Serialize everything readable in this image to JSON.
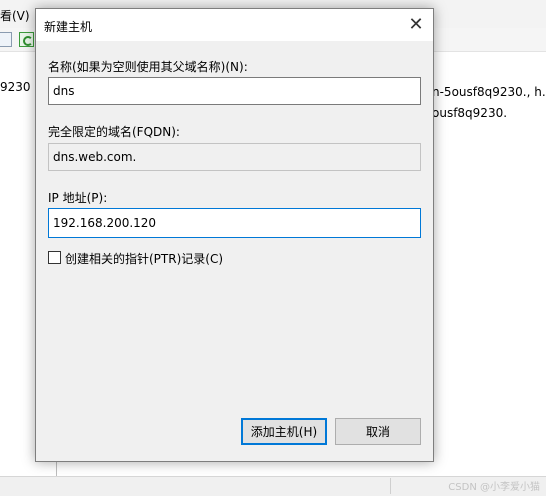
{
  "background": {
    "menu_text": "看(V)",
    "left_row_text": "9230",
    "right_rows": [
      "n-5ousf8q9230., h...",
      "ousf8q9230."
    ],
    "watermark": "CSDN @小李爱小猫"
  },
  "dialog": {
    "title": "新建主机",
    "close_glyph": "✕",
    "name_label": "名称(如果为空则使用其父域名称)(N):",
    "name_value": "dns",
    "fqdn_label": "完全限定的域名(FQDN):",
    "fqdn_value": "dns.web.com.",
    "ip_label": "IP 地址(P):",
    "ip_value": "192.168.200.120",
    "ptr_checkbox_label": "创建相关的指针(PTR)记录(C)",
    "ptr_checked": false,
    "add_host_button": "添加主机(H)",
    "cancel_button": "取消"
  },
  "colors": {
    "accent": "#0078d7",
    "dialog_bg": "#f0f0f0",
    "button_bg": "#e1e1e1"
  },
  "icons": [
    "document-icon",
    "refresh-icon",
    "close-icon"
  ]
}
